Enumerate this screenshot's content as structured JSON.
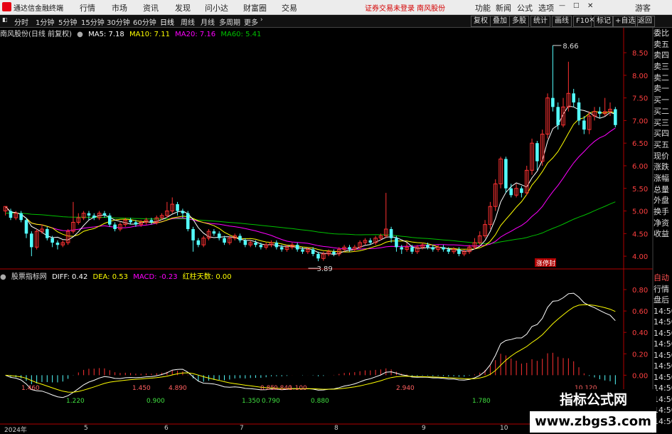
{
  "menubar": {
    "brand": "通达信金融终端",
    "items": [
      "行情",
      "市场",
      "资讯",
      "发现",
      "问小达",
      "财富圈",
      "交易"
    ],
    "ticker": "证券交易未登录  南风股份",
    "right_items": [
      "功能",
      "新闻",
      "公式",
      "选项",
      "游客"
    ]
  },
  "toolbar": {
    "periods": [
      "分时",
      "1分钟",
      "5分钟",
      "15分钟",
      "30分钟",
      "60分钟",
      "日线",
      "周线",
      "月线",
      "多周期",
      "更多"
    ],
    "active": "日线",
    "right_buttons": [
      "复权",
      "叠加",
      "多股",
      "统计",
      "画线",
      "F10",
      "标记",
      "+自选",
      "返回"
    ]
  },
  "main_info": {
    "title": "南风股份(日线 前复权)",
    "ma5": "MA5: 7.18",
    "ma10": "MA10: 7.11",
    "ma20": "MA20: 7.16",
    "ma60": "MA60: 5.41"
  },
  "sub_info": {
    "title": "股票指标网",
    "diff": "DIFF: 0.42",
    "dea": "DEA: 0.53",
    "macd": "MACD: -0.23",
    "days": "红柱天数: 0.00"
  },
  "price_axis": [
    "8.50",
    "8.00",
    "7.50",
    "7.00",
    "6.50",
    "6.00",
    "5.50",
    "5.00",
    "4.50",
    "4.00"
  ],
  "macd_axis": [
    "0.80",
    "0.60",
    "0.40",
    "0.20",
    "0.00"
  ],
  "side_panel": [
    "委比",
    "卖五",
    "卖四",
    "卖三",
    "卖二",
    "卖一",
    "买一",
    "买二",
    "买三",
    "买四",
    "买五",
    "现价",
    "涨跌",
    "涨幅",
    "总量",
    "外盘",
    "换手",
    "净资",
    "收益"
  ],
  "side_panel2": [
    "自动",
    "行情",
    "盘后",
    "14:50",
    "14:50",
    "14:50",
    "14:50",
    "14:50",
    "14:50",
    "14:50",
    "14:50",
    "14:50",
    "14:50",
    "14:50"
  ],
  "price_annotations": {
    "high": "8.66",
    "low": "3.89"
  },
  "tag": "涨停封",
  "macd_annotations": [
    "1.460",
    "1.450",
    "4.890",
    "0.85",
    "0.840",
    "1.100",
    "2.940",
    "10.120",
    "1.220",
    "0.900",
    "1.350",
    "0.790",
    "0.880",
    "1.780"
  ],
  "dates": [
    "2024年",
    "5",
    "6",
    "7",
    "8",
    "9",
    "10"
  ],
  "watermark": {
    "line1": "指标公式网",
    "line2": "www.zbgs3.com"
  },
  "colors": {
    "up": "#ff3232",
    "down": "#54ffff",
    "ma5": "#ffffff",
    "ma10": "#ffff00",
    "ma20": "#ff00ff",
    "ma60": "#00c000",
    "diff": "#ffffff",
    "dea": "#ffff00",
    "macd": "#ff00ff",
    "axis": "#b00000"
  },
  "chart_data": {
    "type": "candlestick",
    "ylim": [
      3.75,
      8.8
    ],
    "candles": [
      [
        5.0,
        5.1,
        5.1,
        4.9
      ],
      [
        5.0,
        4.85,
        5.05,
        4.8
      ],
      [
        4.85,
        4.95,
        5.0,
        4.8
      ],
      [
        4.95,
        4.8,
        5.0,
        4.75
      ],
      [
        4.8,
        4.5,
        4.85,
        4.4
      ],
      [
        4.5,
        4.2,
        4.55,
        4.0
      ],
      [
        4.2,
        4.55,
        4.6,
        4.15
      ],
      [
        4.55,
        4.6,
        4.7,
        4.5
      ],
      [
        4.6,
        4.4,
        4.65,
        4.35
      ],
      [
        4.4,
        4.3,
        4.45,
        4.2
      ],
      [
        4.3,
        4.25,
        4.35,
        4.15
      ],
      [
        4.25,
        4.3,
        4.35,
        4.2
      ],
      [
        4.3,
        4.55,
        4.6,
        4.25
      ],
      [
        4.55,
        4.75,
        5.2,
        4.5
      ],
      [
        4.75,
        4.85,
        4.95,
        4.7
      ],
      [
        4.85,
        4.95,
        5.0,
        4.8
      ],
      [
        4.95,
        4.9,
        5.0,
        4.8
      ],
      [
        4.9,
        4.85,
        4.95,
        4.8
      ],
      [
        4.85,
        4.95,
        5.0,
        4.8
      ],
      [
        4.95,
        4.9,
        5.0,
        4.85
      ],
      [
        4.9,
        4.7,
        4.95,
        4.65
      ],
      [
        4.7,
        4.6,
        4.75,
        4.55
      ],
      [
        4.6,
        4.7,
        4.75,
        4.55
      ],
      [
        4.7,
        4.8,
        4.85,
        4.65
      ],
      [
        4.8,
        4.75,
        4.85,
        4.7
      ],
      [
        4.75,
        4.7,
        4.8,
        4.65
      ],
      [
        4.7,
        4.75,
        4.8,
        4.65
      ],
      [
        4.75,
        4.8,
        4.85,
        4.7
      ],
      [
        4.8,
        4.75,
        4.85,
        4.7
      ],
      [
        4.75,
        4.85,
        4.9,
        4.7
      ],
      [
        4.85,
        4.9,
        4.95,
        4.8
      ],
      [
        4.9,
        5.0,
        5.2,
        4.85
      ],
      [
        5.0,
        5.15,
        5.3,
        4.95
      ],
      [
        5.15,
        5.0,
        5.2,
        4.9
      ],
      [
        5.0,
        4.95,
        5.05,
        4.85
      ],
      [
        4.95,
        4.6,
        5.0,
        4.55
      ],
      [
        4.6,
        4.35,
        4.65,
        4.1
      ],
      [
        4.35,
        4.25,
        4.4,
        4.2
      ],
      [
        4.25,
        4.4,
        4.45,
        4.2
      ],
      [
        4.4,
        4.55,
        4.6,
        4.35
      ],
      [
        4.55,
        4.5,
        4.6,
        4.45
      ],
      [
        4.5,
        4.4,
        4.55,
        4.35
      ],
      [
        4.4,
        4.3,
        4.45,
        4.25
      ],
      [
        4.3,
        4.4,
        4.45,
        4.25
      ],
      [
        4.4,
        4.45,
        4.5,
        4.35
      ],
      [
        4.45,
        4.35,
        4.5,
        4.3
      ],
      [
        4.35,
        4.25,
        4.4,
        4.2
      ],
      [
        4.25,
        4.3,
        4.35,
        4.2
      ],
      [
        4.3,
        4.25,
        4.35,
        4.2
      ],
      [
        4.25,
        4.2,
        4.3,
        4.15
      ],
      [
        4.2,
        4.25,
        4.3,
        4.15
      ],
      [
        4.25,
        4.3,
        4.35,
        4.2
      ],
      [
        4.3,
        4.2,
        4.35,
        4.15
      ],
      [
        4.2,
        4.15,
        4.25,
        4.1
      ],
      [
        4.15,
        4.2,
        4.25,
        4.1
      ],
      [
        4.2,
        4.25,
        4.3,
        4.15
      ],
      [
        4.25,
        4.15,
        4.3,
        4.1
      ],
      [
        4.15,
        4.1,
        4.2,
        4.05
      ],
      [
        4.1,
        4.15,
        4.2,
        4.05
      ],
      [
        4.15,
        4.05,
        4.2,
        4.0
      ],
      [
        4.05,
        3.95,
        4.1,
        3.89
      ],
      [
        3.95,
        4.05,
        4.1,
        3.9
      ],
      [
        4.05,
        4.1,
        4.15,
        4.0
      ],
      [
        4.1,
        4.05,
        4.15,
        4.0
      ],
      [
        4.05,
        4.15,
        4.2,
        4.0
      ],
      [
        4.15,
        4.2,
        4.25,
        4.1
      ],
      [
        4.2,
        4.15,
        4.25,
        4.1
      ],
      [
        4.15,
        4.2,
        4.25,
        4.1
      ],
      [
        4.2,
        4.3,
        4.35,
        4.15
      ],
      [
        4.3,
        4.35,
        4.4,
        4.25
      ],
      [
        4.35,
        4.3,
        4.4,
        4.25
      ],
      [
        4.3,
        4.4,
        4.45,
        4.25
      ],
      [
        4.4,
        4.45,
        4.5,
        4.35
      ],
      [
        4.45,
        4.6,
        5.4,
        4.4
      ],
      [
        4.6,
        4.4,
        4.65,
        4.3
      ],
      [
        4.4,
        4.2,
        4.45,
        4.1
      ],
      [
        4.2,
        4.15,
        4.25,
        4.05
      ],
      [
        4.15,
        4.2,
        4.3,
        4.1
      ],
      [
        4.2,
        4.1,
        4.25,
        4.05
      ],
      [
        4.1,
        4.2,
        4.25,
        4.05
      ],
      [
        4.2,
        4.25,
        4.3,
        4.15
      ],
      [
        4.25,
        4.2,
        4.3,
        4.15
      ],
      [
        4.2,
        4.15,
        4.25,
        4.1
      ],
      [
        4.15,
        4.2,
        4.25,
        4.1
      ],
      [
        4.2,
        4.15,
        4.25,
        4.1
      ],
      [
        4.15,
        4.1,
        4.2,
        4.05
      ],
      [
        4.1,
        4.15,
        4.2,
        4.05
      ],
      [
        4.15,
        4.05,
        4.2,
        4.0
      ],
      [
        4.05,
        4.1,
        4.15,
        4.0
      ],
      [
        4.1,
        4.2,
        4.25,
        4.05
      ],
      [
        4.2,
        4.3,
        4.4,
        4.15
      ],
      [
        4.3,
        4.45,
        4.55,
        4.25
      ],
      [
        4.45,
        4.7,
        4.8,
        4.4
      ],
      [
        4.7,
        5.1,
        5.2,
        4.6
      ],
      [
        5.1,
        5.6,
        5.7,
        5.0
      ],
      [
        5.6,
        6.15,
        6.2,
        5.5
      ],
      [
        6.15,
        5.5,
        6.2,
        5.4
      ],
      [
        5.5,
        5.35,
        5.6,
        5.3
      ],
      [
        5.35,
        5.5,
        5.6,
        5.3
      ],
      [
        5.5,
        5.4,
        5.55,
        5.3
      ],
      [
        5.4,
        5.9,
        6.0,
        5.35
      ],
      [
        5.9,
        6.5,
        6.6,
        5.8
      ],
      [
        6.5,
        6.1,
        6.55,
        5.9
      ],
      [
        6.1,
        6.7,
        6.8,
        6.0
      ],
      [
        6.7,
        7.5,
        7.6,
        6.6
      ],
      [
        7.5,
        7.3,
        8.66,
        7.2
      ],
      [
        7.3,
        6.9,
        7.4,
        6.8
      ],
      [
        6.9,
        7.3,
        7.5,
        6.85
      ],
      [
        7.3,
        7.6,
        8.3,
        7.2
      ],
      [
        7.6,
        7.4,
        7.7,
        7.3
      ],
      [
        7.4,
        7.0,
        7.5,
        6.9
      ],
      [
        7.0,
        6.8,
        7.1,
        6.7
      ],
      [
        6.8,
        7.1,
        7.2,
        6.7
      ],
      [
        7.1,
        7.2,
        7.3,
        7.0
      ],
      [
        7.2,
        7.15,
        7.3,
        7.05
      ],
      [
        7.15,
        7.2,
        7.5,
        7.1
      ],
      [
        7.2,
        7.25,
        7.4,
        7.1
      ],
      [
        7.25,
        6.9,
        7.3,
        6.85
      ]
    ]
  }
}
